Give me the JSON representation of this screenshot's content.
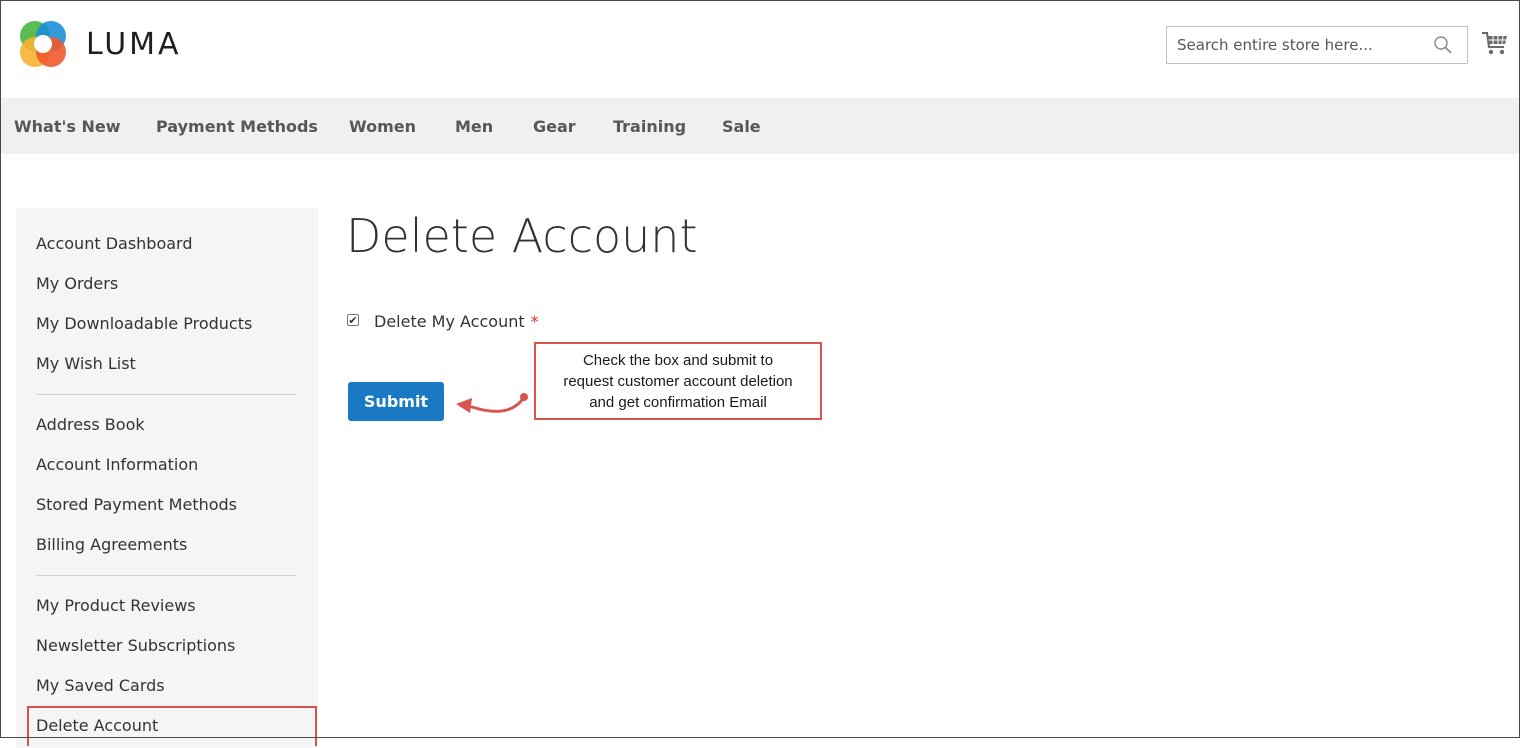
{
  "header": {
    "logo_text": "LUMA",
    "search_placeholder": "Search entire store here..."
  },
  "nav": {
    "items": [
      {
        "label": "What's New"
      },
      {
        "label": "Payment Methods"
      },
      {
        "label": "Women"
      },
      {
        "label": "Men"
      },
      {
        "label": "Gear"
      },
      {
        "label": "Training"
      },
      {
        "label": "Sale"
      }
    ]
  },
  "sidebar": {
    "items": [
      {
        "label": "Account Dashboard"
      },
      {
        "label": "My Orders"
      },
      {
        "label": "My Downloadable Products"
      },
      {
        "label": "My Wish List"
      },
      {
        "label": "Address Book"
      },
      {
        "label": "Account Information"
      },
      {
        "label": "Stored Payment Methods"
      },
      {
        "label": "Billing Agreements"
      },
      {
        "label": "My Product Reviews"
      },
      {
        "label": "Newsletter Subscriptions"
      },
      {
        "label": "My Saved Cards"
      },
      {
        "label": "Delete Account"
      }
    ]
  },
  "main": {
    "title": "Delete Account",
    "checkbox_label": "Delete My Account",
    "checkbox_checked": true,
    "checkmark": "✔",
    "required_mark": "*",
    "submit_label": "Submit"
  },
  "annotation": {
    "lines": [
      "Check the box and submit to",
      "request customer account deletion",
      "and get confirmation Email"
    ]
  },
  "colors": {
    "accent_blue": "#1979c3",
    "annotation_red": "#d9534f",
    "required_red": "#e02b27",
    "nav_bg": "#f0f0f0",
    "sidebar_bg": "#f5f5f5"
  }
}
